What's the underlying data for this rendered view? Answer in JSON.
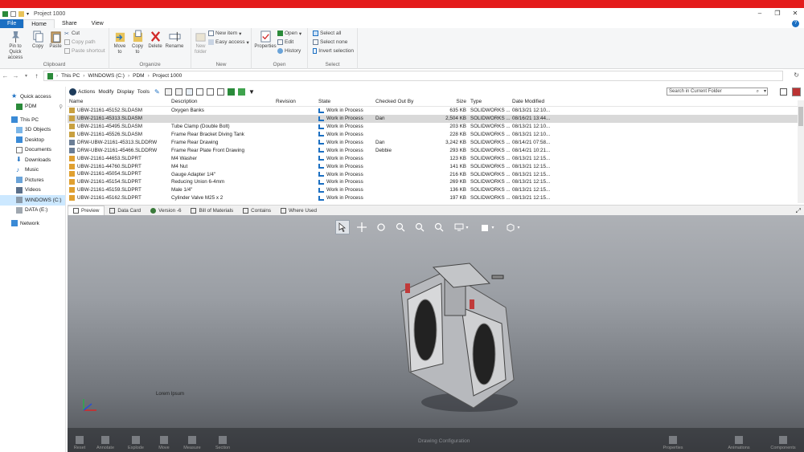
{
  "window": {
    "title": "Project 1000"
  },
  "ribbon_tabs": [
    {
      "label": "File"
    },
    {
      "label": "Home"
    },
    {
      "label": "Share"
    },
    {
      "label": "View"
    }
  ],
  "clipboard": {
    "pin_label": "Pin to Quick access",
    "copy_label": "Copy",
    "paste_label": "Paste",
    "cut_label": "Cut",
    "copy_path_label": "Copy path",
    "paste_shortcut_label": "Paste shortcut",
    "group_label": "Clipboard"
  },
  "organize": {
    "move_label": "Move to",
    "copy_label": "Copy to",
    "delete_label": "Delete",
    "rename_label": "Rename",
    "group_label": "Organize"
  },
  "new": {
    "new_folder_label": "New folder",
    "new_item_label": "New item",
    "easy_access_label": "Easy access",
    "group_label": "New"
  },
  "open": {
    "properties_label": "Properties",
    "open_label": "Open",
    "edit_label": "Edit",
    "history_label": "History",
    "group_label": "Open"
  },
  "select": {
    "select_all_label": "Select all",
    "select_none_label": "Select none",
    "invert_label": "Invert selection",
    "group_label": "Select"
  },
  "address": {
    "crumbs": [
      "This PC",
      "WINDOWS (C:)",
      "PDM",
      "Project 1000"
    ]
  },
  "nav": {
    "items": [
      {
        "label": "Quick access"
      },
      {
        "label": "PDM"
      },
      {
        "label": "This PC"
      },
      {
        "label": "3D Objects"
      },
      {
        "label": "Desktop"
      },
      {
        "label": "Documents"
      },
      {
        "label": "Downloads"
      },
      {
        "label": "Music"
      },
      {
        "label": "Pictures"
      },
      {
        "label": "Videos"
      },
      {
        "label": "WINDOWS (C:)"
      },
      {
        "label": "DATA (E:)"
      },
      {
        "label": "Network"
      }
    ]
  },
  "pdm_toolbar": {
    "menus": [
      "Actions",
      "Modify",
      "Display",
      "Tools"
    ],
    "search_placeholder": "Search in Current Folder"
  },
  "table": {
    "headers": {
      "name": "Name",
      "desc": "Description",
      "rev": "Revision",
      "state": "State",
      "by": "Checked Out By",
      "size": "Size",
      "type": "Type",
      "date": "Date Modified"
    },
    "rows": [
      {
        "name": "UBW-21161-45152.SLDASM",
        "desc": "Oxygen Banks",
        "rev": "",
        "state": "Work in Process",
        "by": "",
        "size": "635 KB",
        "type": "SOLIDWORKS ...",
        "date": "08/13/21 12:10..."
      },
      {
        "name": "UBW-21161-45313.SLDASM",
        "desc": "",
        "rev": "",
        "state": "Work in Process",
        "by": "Dan",
        "size": "2,504 KB",
        "type": "SOLIDWORKS ...",
        "date": "08/16/21 13:44..."
      },
      {
        "name": "UBW-21161-45495.SLDASM",
        "desc": "Tube Clamp (Double Bolt)",
        "rev": "",
        "state": "Work in Process",
        "by": "",
        "size": "203 KB",
        "type": "SOLIDWORKS ...",
        "date": "08/13/21 12:10..."
      },
      {
        "name": "UBW-21161-45526.SLDASM",
        "desc": "Frame Rear Bracket Diving Tank",
        "rev": "",
        "state": "Work in Process",
        "by": "",
        "size": "228 KB",
        "type": "SOLIDWORKS ...",
        "date": "08/13/21 12:10..."
      },
      {
        "name": "DRW-UBW-21161-45313.SLDDRW",
        "desc": "Frame Rear Drawing",
        "rev": "",
        "state": "Work in Process",
        "by": "Dan",
        "size": "3,242 KB",
        "type": "SOLIDWORKS ...",
        "date": "08/14/21 07:58..."
      },
      {
        "name": "DRW-UBW-21161-45466.SLDDRW",
        "desc": "Frame Rear Plate Front Drawing",
        "rev": "",
        "state": "Work in Process",
        "by": "Debbie",
        "size": "293 KB",
        "type": "SOLIDWORKS ...",
        "date": "08/14/21 10:21..."
      },
      {
        "name": "UBW-21161-44653.SLDPRT",
        "desc": "M4 Washer",
        "rev": "",
        "state": "Work in Process",
        "by": "",
        "size": "123 KB",
        "type": "SOLIDWORKS ...",
        "date": "08/13/21 12:15..."
      },
      {
        "name": "UBW-21161-44760.SLDPRT",
        "desc": "M4 Nut",
        "rev": "",
        "state": "Work in Process",
        "by": "",
        "size": "141 KB",
        "type": "SOLIDWORKS ...",
        "date": "08/13/21 12:15..."
      },
      {
        "name": "UBW-21161-45054.SLDPRT",
        "desc": "Gauge Adapter 1/4\"",
        "rev": "",
        "state": "Work in Process",
        "by": "",
        "size": "216 KB",
        "type": "SOLIDWORKS ...",
        "date": "08/13/21 12:15..."
      },
      {
        "name": "UBW-21161-45154.SLDPRT",
        "desc": "Reducing Union 6-4mm",
        "rev": "",
        "state": "Work in Process",
        "by": "",
        "size": "269 KB",
        "type": "SOLIDWORKS ...",
        "date": "08/13/21 12:15..."
      },
      {
        "name": "UBW-21161-45159.SLDPRT",
        "desc": "Male 1/4\"",
        "rev": "",
        "state": "Work in Process",
        "by": "",
        "size": "136 KB",
        "type": "SOLIDWORKS ...",
        "date": "08/13/21 12:15..."
      },
      {
        "name": "UBW-21161-45162.SLDPRT",
        "desc": "Cylinder Valve M25 x 2",
        "rev": "",
        "state": "Work in Process",
        "by": "",
        "size": "197 KB",
        "type": "SOLIDWORKS ...",
        "date": "08/13/21 12:15..."
      }
    ]
  },
  "preview_tabs": [
    {
      "label": "Preview"
    },
    {
      "label": "Data Card"
    },
    {
      "label": "Version -6"
    },
    {
      "label": "Bill of Materials"
    },
    {
      "label": "Contains"
    },
    {
      "label": "Where Used"
    }
  ],
  "viewer": {
    "model_label": "Lorem Ipsum",
    "bottom": {
      "reset": "Reset",
      "annotate": "Annotate",
      "explode": "Explode",
      "move": "Move",
      "measure": "Measure",
      "section": "Section",
      "center": "Drawing Configuration",
      "properties": "Properties",
      "animations": "Animations",
      "components": "Components"
    }
  },
  "colors": {
    "accent": "#1b6fc2",
    "brand_bar": "#e41b1b",
    "selection": "#cce8ff"
  }
}
